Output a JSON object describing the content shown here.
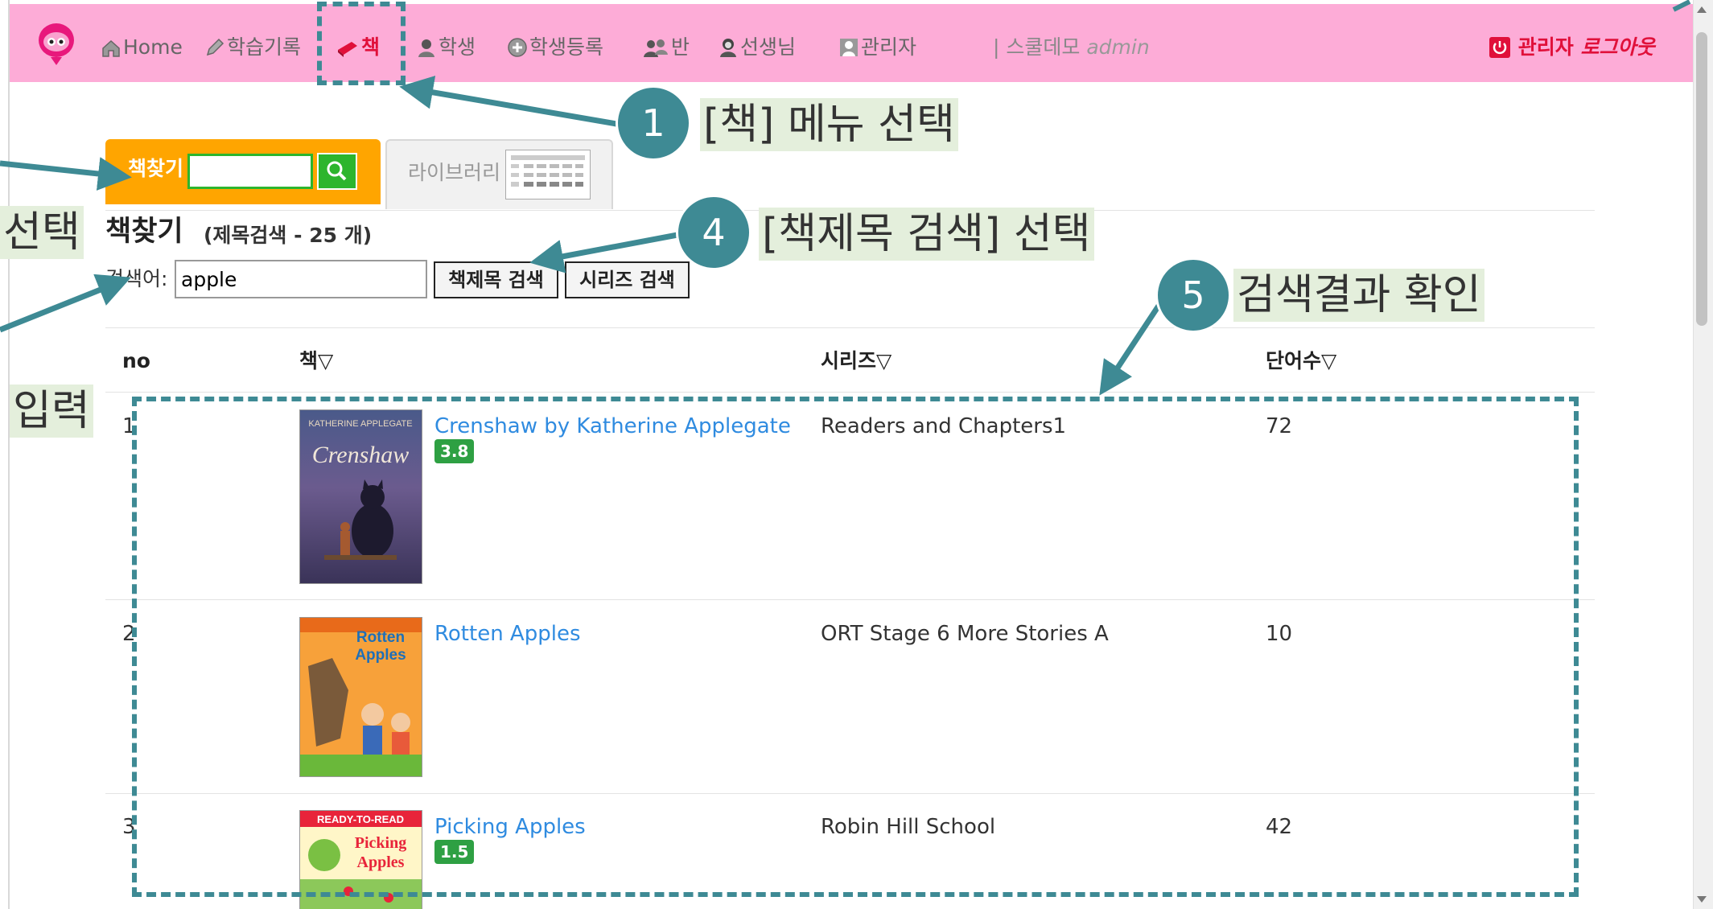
{
  "nav": {
    "items": [
      {
        "label": "Home"
      },
      {
        "label": "학습기록"
      },
      {
        "label": "책"
      },
      {
        "label": "학생"
      },
      {
        "label": "학생등록"
      },
      {
        "label": "반"
      },
      {
        "label": "선생님"
      },
      {
        "label": "관리자"
      }
    ],
    "school_prefix": "| 스쿨데모",
    "school_user": "admin",
    "logout_prefix": "관리자",
    "logout_label": "로그아웃"
  },
  "tabs": {
    "search_label": "책찾기",
    "library_label": "라이브러리"
  },
  "page": {
    "title": "책찾기",
    "subtitle": "(제목검색 - 25 개)"
  },
  "search": {
    "label": "검색어:",
    "value": "apple",
    "title_button": "책제목 검색",
    "series_button": "시리즈 검색"
  },
  "table": {
    "columns": [
      "no",
      "책▽",
      "시리즈▽",
      "단어수▽"
    ],
    "rows": [
      {
        "no": "1",
        "title": "Crenshaw by Katherine Applegate",
        "level": "3.8",
        "series": "Readers and Chapters1",
        "words": "72",
        "cover_text": "Crenshaw"
      },
      {
        "no": "2",
        "title": "Rotten Apples",
        "level": "",
        "series": "ORT Stage 6 More Stories A",
        "words": "10",
        "cover_text": "Rotten Apples"
      },
      {
        "no": "3",
        "title": "Picking Apples",
        "level": "1.5",
        "series": "Robin Hill School",
        "words": "42",
        "cover_text": "Picking Apples"
      }
    ]
  },
  "annotations": [
    {
      "number": "1",
      "text": "[책] 메뉴 선택"
    },
    {
      "number": "4",
      "text": "[책제목 검색] 선택"
    },
    {
      "number": "5",
      "text": "검색결과 확인"
    },
    {
      "number": "",
      "text": "선택"
    },
    {
      "number": "",
      "text": "입력"
    }
  ],
  "colors": {
    "navbar": "#fdacd7",
    "active_menu": "#e0103a",
    "orange_tab": "#ffa500",
    "green": "#2db52d",
    "annotation": "#3e8a94",
    "note_bg": "#e4efdc",
    "link": "#2f8be0"
  }
}
